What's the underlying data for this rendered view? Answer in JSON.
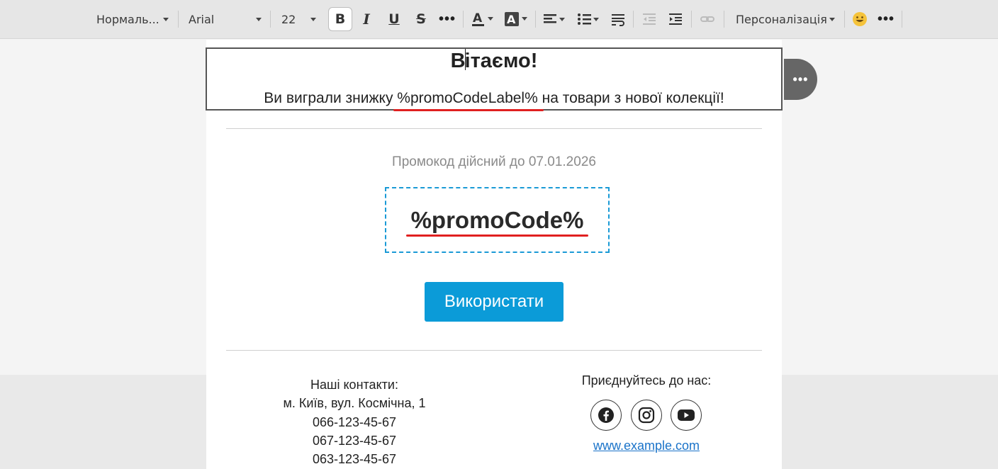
{
  "toolbar": {
    "paragraph_style": "Нормаль...",
    "font_family": "Arial",
    "font_size": "22",
    "bold": "B",
    "italic": "I",
    "underline": "U",
    "strike": "S",
    "more": "•••",
    "personalization": "Персоналізація",
    "emoji": "😀",
    "more_end": "•••",
    "icons": [
      "font-color-icon",
      "highlight-color-icon",
      "align-icon",
      "list-icon",
      "paragraph-format-icon",
      "outdent-icon",
      "indent-icon",
      "link-icon"
    ]
  },
  "email": {
    "title": "Вітаємо!",
    "subtitle": "Ви виграли знижку %promoCodeLabel% на товари з нової колекції!",
    "validity": "Промокод  дійсний до 07.01.2026",
    "promo_code": "%promoCode%",
    "use_button": "Використати",
    "contacts_title": "Наші контакти:",
    "address": "м. Київ, вул. Космічна, 1",
    "phones": [
      "066-123-45-67",
      "067-123-45-67",
      "063-123-45-67"
    ],
    "join_title": "Приєднуйтесь до нас:",
    "social": [
      "facebook-icon",
      "instagram-icon",
      "youtube-icon"
    ],
    "website": "www.example.com",
    "side_handle": "•••"
  },
  "colors": {
    "accent": "#0b9bd8",
    "dashed_border": "#1a9ad6",
    "spellcheck": "#e02020",
    "link": "#1a73c9"
  }
}
